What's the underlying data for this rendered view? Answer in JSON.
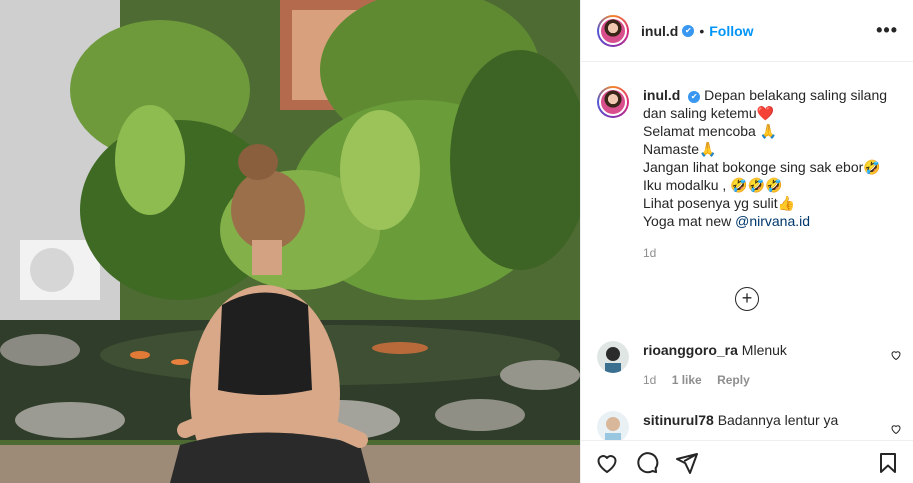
{
  "post": {
    "username": "inul.d",
    "separator": "•",
    "follow_label": "Follow",
    "more_label": "•••",
    "verified_mark": "✔"
  },
  "caption": {
    "username": "inul.d",
    "lines": [
      "Depan belakang saling silang",
      "dan saling ketemu❤️",
      "Selamat mencoba 🙏",
      "Namaste🙏",
      "Jangan lihat bokonge sing sak ebor🤣",
      "Iku modalku , 🤣🤣🤣",
      "Lihat posenya yg sulit👍",
      "Yoga mat new "
    ],
    "mention": "@nirvana.id",
    "time": "1d"
  },
  "load_more_label": "+",
  "comments": [
    {
      "username": "rioanggoro_ra",
      "text": "Mlenuk",
      "time": "1d",
      "likes": "1 like",
      "reply": "Reply"
    },
    {
      "username": "sitinurul78",
      "text": "Badannya lentur ya"
    }
  ],
  "icons": {
    "like": "heart-icon",
    "comment": "comment-icon",
    "share": "share-icon",
    "save": "bookmark-icon"
  },
  "colors": {
    "link": "#0095f6",
    "verified": "#3897f0",
    "muted": "#8e8e8e"
  }
}
